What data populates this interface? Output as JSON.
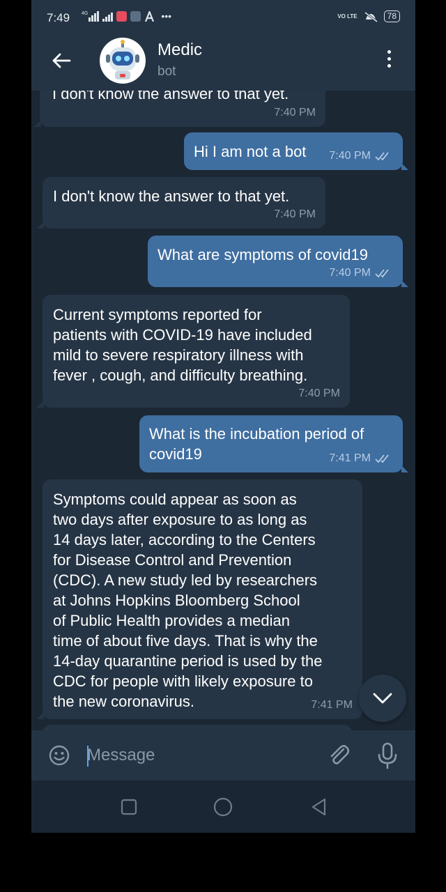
{
  "status_bar": {
    "time": "7:49",
    "network_left": "4G",
    "volte": "VO LTE",
    "battery": "78"
  },
  "header": {
    "title": "Medic",
    "subtitle": "bot"
  },
  "messages": [
    {
      "side": "in",
      "text": "I don't know the answer to that yet.",
      "time": "7:40 PM"
    },
    {
      "side": "out",
      "text": "Hi I am not a bot",
      "time": "7:40 PM"
    },
    {
      "side": "in",
      "text": "I don't know the answer to that yet.",
      "time": "7:40 PM"
    },
    {
      "side": "out",
      "text": "What are symptoms of covid19",
      "time": "7:40 PM"
    },
    {
      "side": "in",
      "text": "Current symptoms reported for\npatients with COVID-19 have included\nmild to severe respiratory illness with\nfever , cough, and difficulty breathing.",
      "time": "7:40 PM"
    },
    {
      "side": "out",
      "text": "What is the incubation period of\ncovid19",
      "time": "7:41 PM"
    },
    {
      "side": "in",
      "text": "Symptoms could appear as soon as\ntwo days after exposure to as long as\n14 days later, according to the Centers\nfor Disease Control and Prevention\n(CDC). A new study led by researchers\nat Johns Hopkins Bloomberg School\nof Public Health provides a median\ntime of about five days. That is why the\n14-day quarantine period is used by the\nCDC for people with likely exposure to\nthe new coronavirus.",
      "time": "7:41 PM"
    }
  ],
  "composer": {
    "placeholder": "Message"
  },
  "colors": {
    "chat_bg": "#1c2734",
    "bubble_in": "#263545",
    "bubble_out": "#3f6ea0",
    "header_bg": "#243444",
    "check_blue": "#5ea6e8"
  }
}
